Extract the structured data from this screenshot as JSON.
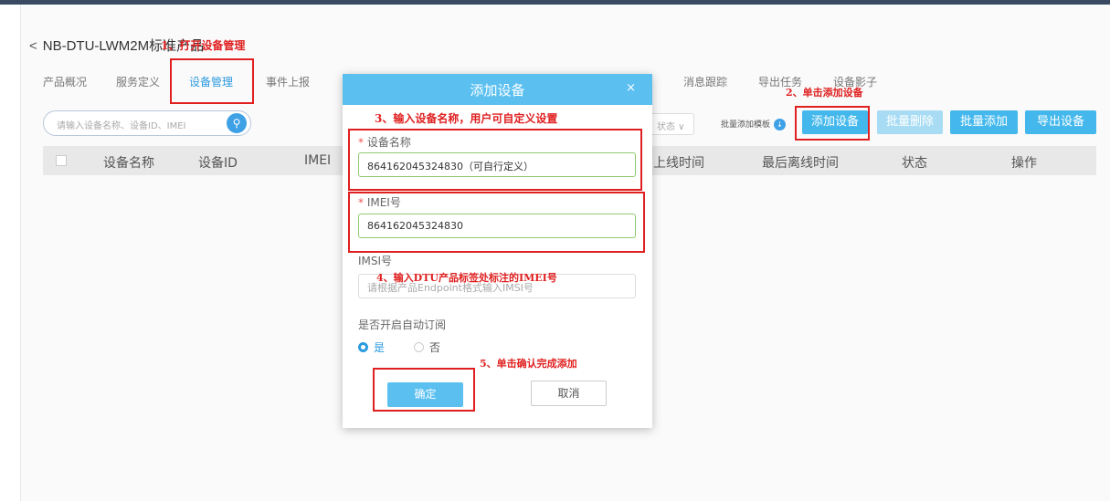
{
  "header": {
    "back_glyph": "<",
    "title": "NB-DTU-LWM2M标准产品"
  },
  "tabs": [
    "产品概况",
    "服务定义",
    "设备管理",
    "事件上报",
    "消息跟踪",
    "导出任务",
    "设备影子"
  ],
  "toolbar": {
    "search_placeholder": "请输入设备名称、设备ID、IMEI",
    "status_placeholder": "状态 ∨",
    "template_label": "批量添加模板",
    "add_device": "添加设备",
    "bulk_delete": "批量删除",
    "bulk_add": "批量添加",
    "export_device": "导出设备"
  },
  "table": {
    "columns": [
      "设备名称",
      "设备ID",
      "IMEI",
      "上线时间",
      "最后离线时间",
      "状态",
      "操作"
    ]
  },
  "modal": {
    "title": "添加设备",
    "close": "×",
    "device_name_label": "设备名称",
    "device_name_value": "864162045324830（可自行定义）",
    "imei_label": "IMEI号",
    "imei_value": "864162045324830",
    "imsi_label": "IMSI号",
    "imsi_placeholder": "请根据产品Endpoint格式输入IMSI号",
    "subscribe_label": "是否开启自动订阅",
    "yes": "是",
    "no": "否",
    "confirm": "确定",
    "cancel": "取消",
    "required_mark": "*"
  },
  "annotations": {
    "step1": "1、打开设备管理",
    "step2": "2、单击添加设备",
    "step3": "3、输入设备名称，用户可自定义设置",
    "step4": "4、输入DTU产品标签处标注的IMEI号",
    "step5": "5、单击确认完成添加"
  },
  "colors": {
    "accent": "#5bc0f0",
    "annotation": "#e02020",
    "active_tab": "#2c9ae0"
  }
}
